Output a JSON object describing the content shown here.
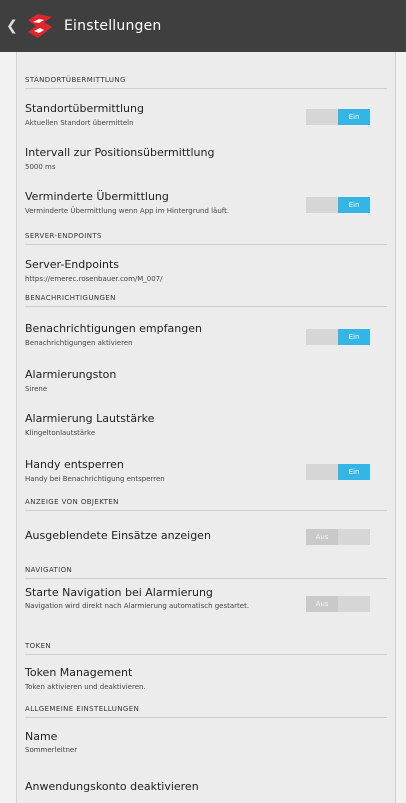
{
  "header": {
    "title": "Einstellungen",
    "back_icon": "chevron-left-icon",
    "logo": "app-logo"
  },
  "sections": {
    "standort": "STANDORTÜBERMITTLUNG",
    "server": "SERVER-ENDPOINTS",
    "benachrichtigungen": "BENACHRICHTIGUNGEN",
    "anzeige": "ANZEIGE VON OBJEKTEN",
    "navigation": "NAVIGATION",
    "token": "TOKEN",
    "allgemein": "ALLGEMEINE EINSTELLUNGEN"
  },
  "settings": {
    "standort": {
      "title": "Standortübermittlung",
      "subtitle": "Aktuellen Standort übermitteln",
      "state": "Ein"
    },
    "intervall": {
      "title": "Intervall zur Positionsübermittlung",
      "subtitle": "5000 ms"
    },
    "vermindert": {
      "title": "Verminderte Übermittlung",
      "subtitle": "Verminderte Übermittlung wenn App im Hintergrund läuft.",
      "state": "Ein"
    },
    "endpoints": {
      "title": "Server-Endpoints",
      "subtitle": "https://emerec.rosenbauer.com/M_007/"
    },
    "empfangen": {
      "title": "Benachrichtigungen empfangen",
      "subtitle": "Benachrichtigungen aktivieren",
      "state": "Ein"
    },
    "alarmton": {
      "title": "Alarmierungston",
      "subtitle": "Sirene"
    },
    "lautstaerke": {
      "title": "Alarmierung Lautstärke",
      "subtitle": "Klingeltonlautstärke"
    },
    "entsperren": {
      "title": "Handy entsperren",
      "subtitle": "Handy bei Benachrichtigung entsperren",
      "state": "Ein"
    },
    "ausgeblendet": {
      "title": "Ausgeblendete Einsätze anzeigen",
      "state": "Aus"
    },
    "navigation": {
      "title": "Starte Navigation bei Alarmierung",
      "subtitle": "Navigation wird direkt nach Alarmierung automatisch gestartet.",
      "state": "Aus"
    },
    "token": {
      "title": "Token Management",
      "subtitle": "Token aktivieren und deaktivieren."
    },
    "name": {
      "title": "Name",
      "subtitle": "Sommerleitner"
    },
    "konto": {
      "title": "Anwendungskonto deaktivieren"
    }
  },
  "colors": {
    "actionbar": "#3f3f3f",
    "accent": "#33b5e5",
    "logo_red": "#e0262b"
  }
}
